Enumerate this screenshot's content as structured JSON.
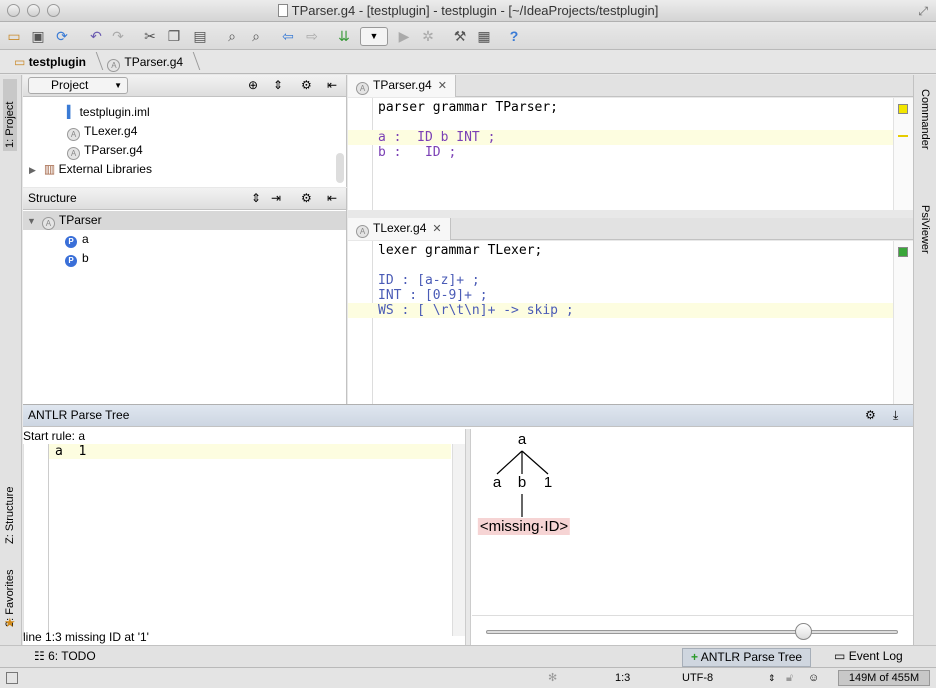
{
  "window": {
    "title": "TParser.g4 - [testplugin] - testplugin - [~/IdeaProjects/testplugin]"
  },
  "navbar": {
    "project": "testplugin",
    "file": "TParser.g4"
  },
  "left_strip": {
    "project_tab": "1: Project",
    "structure_tab": "Z: Structure",
    "favorites_tab": "2: Favorites"
  },
  "right_strip": {
    "commander_tab": "Commander",
    "psiviewer_tab": "PsiViewer"
  },
  "project_panel": {
    "view_selector": "Project",
    "items": [
      {
        "label": "testplugin.iml",
        "icon": "iml-file-icon"
      },
      {
        "label": "TLexer.g4",
        "icon": "grammar-file-icon"
      },
      {
        "label": "TParser.g4",
        "icon": "grammar-file-icon"
      },
      {
        "label": "External Libraries",
        "icon": "library-icon"
      }
    ]
  },
  "structure_panel": {
    "title": "Structure",
    "root": "TParser",
    "rules": [
      "a",
      "b"
    ]
  },
  "editor_top": {
    "tab": "TParser.g4",
    "lines": [
      "parser grammar TParser;",
      "",
      "a :  ID b INT ;",
      "b :   ID ;"
    ]
  },
  "editor_bottom": {
    "tab": "TLexer.g4",
    "lines": [
      "lexer grammar TLexer;",
      "",
      "ID : [a-z]+ ;",
      "INT : [0-9]+ ;",
      "WS : [ \\r\\t\\n]+ -> skip ;"
    ]
  },
  "antlr": {
    "title": "ANTLR Parse Tree",
    "start_rule": "Start rule: a",
    "input": "a  1",
    "message": "line 1:3 missing ID at '1'",
    "tree": {
      "root": "a",
      "children": [
        "a",
        "b",
        "1"
      ],
      "error_node": "<missing·ID>"
    },
    "zoom_fraction": 0.77
  },
  "bottom_tabs": {
    "todo": "6: TODO",
    "antlr": "ANTLR Parse Tree",
    "eventlog": "Event Log"
  },
  "status": {
    "position": "1:3",
    "encoding": "UTF-8",
    "memory": "149M of 455M"
  },
  "colors": {
    "error_bg": "#f6d4d4",
    "highlight": "#fdfde0",
    "rule": "#7b40b5",
    "token": "#4a5bb6"
  }
}
